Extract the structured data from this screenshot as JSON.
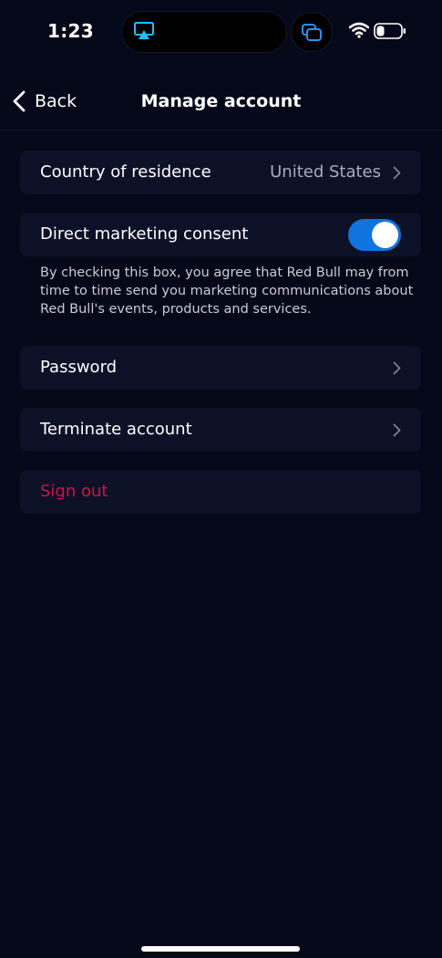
{
  "status_bar": {
    "time": "1:23"
  },
  "nav": {
    "back_label": "Back",
    "title": "Manage account"
  },
  "settings": {
    "country": {
      "label": "Country of residence",
      "value": "United States"
    },
    "marketing": {
      "label": "Direct marketing consent",
      "enabled": true,
      "description": "By checking this box, you agree that Red Bull may from time to time send you marketing communications about Red Bull's events, products and services."
    },
    "password": {
      "label": "Password"
    },
    "terminate": {
      "label": "Terminate account"
    },
    "signout": {
      "label": "Sign out"
    }
  },
  "colors": {
    "background": "#050818",
    "card": "#0c1128",
    "toggle_on": "#0f74e0",
    "signout": "#d21246",
    "secondary_text": "#a8acb9"
  },
  "icons": {
    "airplay": "airplay-icon",
    "screen_mirror": "screen-mirror-icon",
    "wifi": "wifi-icon",
    "battery": "battery-icon",
    "back": "chevron-left-icon",
    "disclosure": "chevron-right-icon"
  }
}
